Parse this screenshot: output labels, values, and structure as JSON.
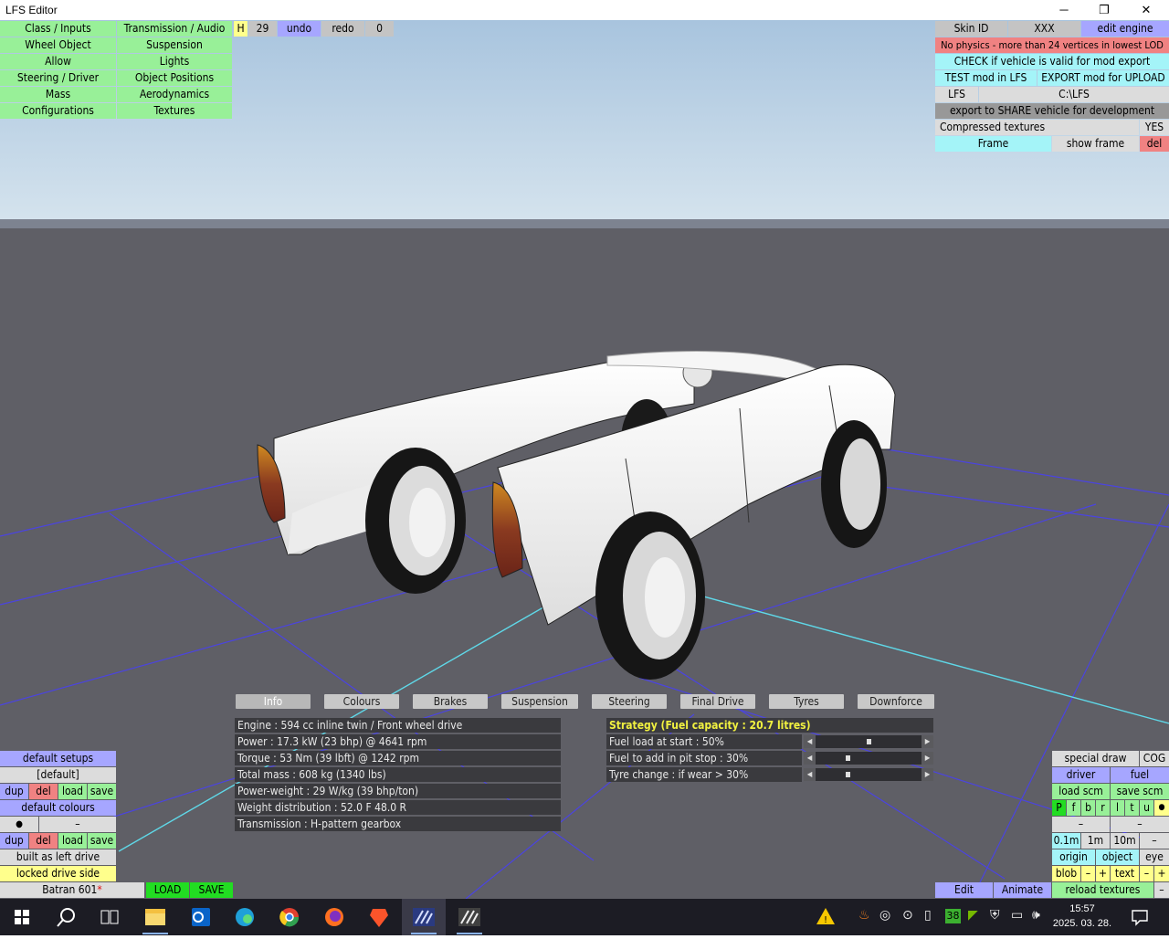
{
  "window": {
    "title": "LFS Editor",
    "minimize": "─",
    "restore": "❐",
    "close": "✕"
  },
  "left_menu": [
    [
      "Class / Inputs",
      "Transmission / Audio"
    ],
    [
      "Wheel Object",
      "Suspension"
    ],
    [
      "Allow",
      "Lights"
    ],
    [
      "Steering / Driver",
      "Object Positions"
    ],
    [
      "Mass",
      "Aerodynamics"
    ],
    [
      "Configurations",
      "Textures"
    ]
  ],
  "top_strip": {
    "h": "H",
    "count": "29",
    "undo": "undo",
    "redo": "redo",
    "zero": "0"
  },
  "right_panel": {
    "skin_id": "Skin ID",
    "xxx": "XXX",
    "edit_engine": "edit engine",
    "warning": "No physics - more than 24 vertices in lowest LOD",
    "check": "CHECK if vehicle is valid for mod export",
    "test": "TEST mod in LFS",
    "export_upload": "EXPORT mod for UPLOAD",
    "lfs": "LFS",
    "lfs_path": "C:\\LFS",
    "export_share": "export to SHARE vehicle for development",
    "compressed": "Compressed textures",
    "compressed_value": "YES",
    "frame": "Frame",
    "show_frame": "show frame",
    "del": "del"
  },
  "tabs": [
    "Info",
    "Colours",
    "Brakes",
    "Suspension",
    "Steering",
    "Final Drive",
    "Tyres",
    "Downforce"
  ],
  "info_lines": [
    "Engine : 594 cc inline twin / Front wheel drive",
    "Power : 17.3 kW (23 bhp) @ 4641 rpm",
    "Torque : 53 Nm (39 lbft) @ 1242 rpm",
    "Total mass : 608 kg (1340 lbs)",
    "Power-weight : 29 W/kg (39 bhp/ton)",
    "Weight distribution : 52.0 F  48.0 R",
    "Transmission : H-pattern gearbox"
  ],
  "strategy": {
    "title": "Strategy (Fuel capacity : 20.7 litres)",
    "rows": [
      {
        "label": "Fuel load at start : 50%",
        "value": 0.5
      },
      {
        "label": "Fuel to add in pit stop : 30%",
        "value": 0.3
      },
      {
        "label": "Tyre change : if wear > 30%",
        "value": 0.3
      }
    ]
  },
  "bottom_left": {
    "default_setups": "default setups",
    "default_label": "[default]",
    "dup": "dup",
    "del": "del",
    "load": "load",
    "save": "save",
    "default_colours": "default colours",
    "dot": "●",
    "dash": "–",
    "built": "built as left drive",
    "locked": "locked drive side",
    "vehicle_name": "Batran 601",
    "star": "*",
    "load_big": "LOAD",
    "save_big": "SAVE"
  },
  "bottom_right": {
    "special_draw": "special draw",
    "cog": "COG",
    "driver": "driver",
    "fuel": "fuel",
    "load_scm": "load scm",
    "save_scm": "save scm",
    "letters": [
      "P",
      "f",
      "b",
      "r",
      "l",
      "t",
      "u"
    ],
    "dot": "●",
    "dash": "–",
    "scale": [
      "0.1m",
      "1m",
      "10m",
      "–"
    ],
    "origin": "origin",
    "object": "object",
    "eye": "eye",
    "blob": "blob",
    "minus": "–",
    "plus": "+",
    "text": "text",
    "edit": "Edit",
    "animate": "Animate",
    "reload": "reload textures"
  },
  "taskbar": {
    "time": "15:57",
    "date": "2025. 03. 28.",
    "badge": "38"
  },
  "colors": {
    "sky": "#b9d2e6",
    "ground": "#5f5f66",
    "grid": "#4f46e8",
    "car": "#f0f0f0"
  }
}
